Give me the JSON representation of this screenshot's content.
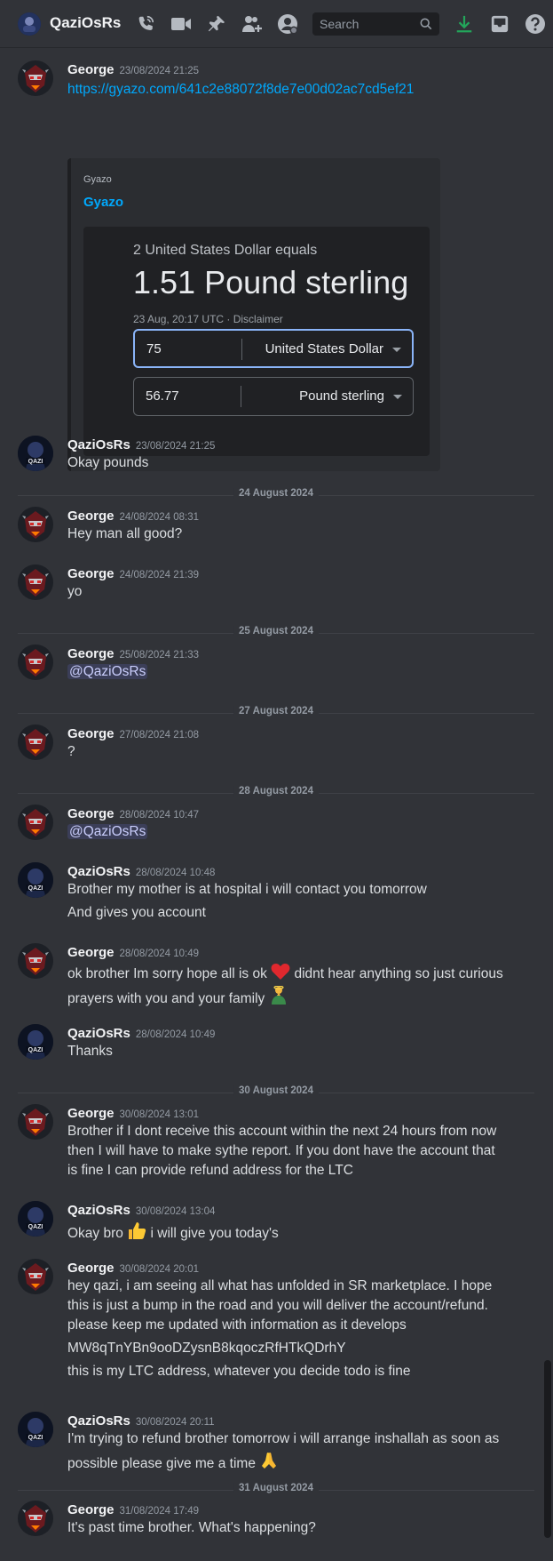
{
  "header": {
    "channel_name": "QaziOsRs",
    "search_placeholder": "Search",
    "icons": [
      "phone-call-icon",
      "video-icon",
      "pin-icon",
      "add-friend-icon",
      "profile-icon",
      "search-icon",
      "download-icon",
      "inbox-icon",
      "help-icon"
    ],
    "accent": "#23a55a"
  },
  "messages": [
    {
      "author": "George",
      "timestamp": "23/08/2024 21:25",
      "lines": [
        "https://gyazo.com/641c2e88072f8de7e00d02ac7cd5ef21"
      ]
    },
    {
      "author": "QaziOsRs",
      "timestamp": "23/08/2024 21:25",
      "lines": [
        "Okay pounds"
      ]
    },
    {
      "author": "George",
      "timestamp": "24/08/2024 08:31",
      "lines": [
        "Hey man all good?"
      ]
    },
    {
      "author": "George",
      "timestamp": "24/08/2024 21:39",
      "lines": [
        "yo"
      ]
    },
    {
      "author": "George",
      "timestamp": "25/08/2024 21:33",
      "lines": [
        "@QaziOsRs"
      ]
    },
    {
      "author": "George",
      "timestamp": "27/08/2024 21:08",
      "lines": [
        "?"
      ]
    },
    {
      "author": "George",
      "timestamp": "28/08/2024 10:47",
      "lines": [
        "@QaziOsRs"
      ]
    },
    {
      "author": "QaziOsRs",
      "timestamp": "28/08/2024 10:48",
      "lines": [
        "Brother my mother is at hospital i will contact you tomorrow",
        "And gives you account"
      ]
    },
    {
      "author": "George",
      "timestamp": "28/08/2024 10:49",
      "lines": [
        "ok brother Im sorry hope all is ok",
        "didnt hear anything so just curious",
        "prayers with you and your family"
      ]
    },
    {
      "author": "QaziOsRs",
      "timestamp": "28/08/2024 10:49",
      "lines": [
        "Thanks"
      ]
    },
    {
      "author": "George",
      "timestamp": "30/08/2024 13:01",
      "lines": [
        "Brother if I dont receive this account within the next 24 hours from now",
        "then I will have to make sythe report. If you dont have the account that",
        "is fine I can provide refund address for the LTC"
      ]
    },
    {
      "author": "QaziOsRs",
      "timestamp": "30/08/2024 13:04",
      "lines": [
        "Okay bro",
        "i will give you today's"
      ]
    },
    {
      "author": "George",
      "timestamp": "30/08/2024 20:01",
      "lines": [
        "hey qazi, i am seeing all what has unfolded in SR marketplace. I hope",
        "this is just a bump in the road and you will deliver the account/refund.",
        "please keep me updated with information as it develops",
        "MW8qTnYBn9ooDZysnB8kqoczRfHTkQDrhY",
        "this is my LTC address, whatever you decide todo is fine"
      ]
    },
    {
      "author": "QaziOsRs",
      "timestamp": "30/08/2024 20:11",
      "lines": [
        "I'm trying to refund brother tomorrow i will arrange inshallah as soon as",
        "possible please give me a time"
      ]
    },
    {
      "author": "George",
      "timestamp": "31/08/2024 17:49",
      "lines": [
        "It's past time brother. What's happening?"
      ]
    }
  ],
  "dividers": [
    "24 August 2024",
    "25 August 2024",
    "27 August 2024",
    "28 August 2024",
    "30 August 2024",
    "31 August 2024"
  ],
  "embed": {
    "provider": "Gyazo",
    "title": "Gyazo",
    "image": {
      "line1": "2 United States Dollar equals",
      "line2": "1.51 Pound sterling",
      "line3": "23 Aug, 20:17 UTC · Disclaimer",
      "from_amount": "75",
      "from_currency": "United States Dollar",
      "to_amount": "56.77",
      "to_currency": "Pound sterling"
    }
  }
}
